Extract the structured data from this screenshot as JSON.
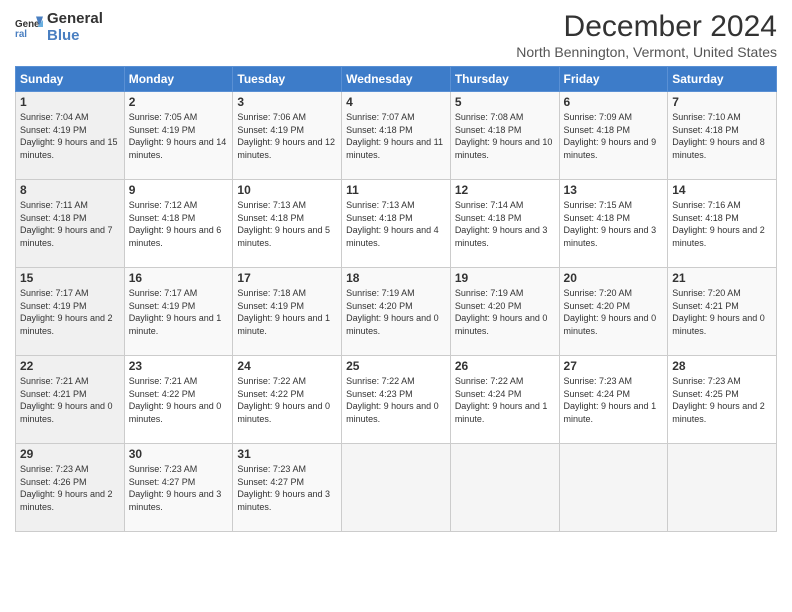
{
  "header": {
    "logo": {
      "general": "General",
      "blue": "Blue"
    },
    "title": "December 2024",
    "subtitle": "North Bennington, Vermont, United States"
  },
  "calendar": {
    "days": [
      "Sunday",
      "Monday",
      "Tuesday",
      "Wednesday",
      "Thursday",
      "Friday",
      "Saturday"
    ],
    "weeks": [
      [
        null,
        {
          "day": 2,
          "sunrise": "7:05 AM",
          "sunset": "4:19 PM",
          "daylight": "9 hours and 14 minutes."
        },
        {
          "day": 3,
          "sunrise": "7:06 AM",
          "sunset": "4:19 PM",
          "daylight": "9 hours and 12 minutes."
        },
        {
          "day": 4,
          "sunrise": "7:07 AM",
          "sunset": "4:18 PM",
          "daylight": "9 hours and 11 minutes."
        },
        {
          "day": 5,
          "sunrise": "7:08 AM",
          "sunset": "4:18 PM",
          "daylight": "9 hours and 10 minutes."
        },
        {
          "day": 6,
          "sunrise": "7:09 AM",
          "sunset": "4:18 PM",
          "daylight": "9 hours and 9 minutes."
        },
        {
          "day": 7,
          "sunrise": "7:10 AM",
          "sunset": "4:18 PM",
          "daylight": "9 hours and 8 minutes."
        }
      ],
      [
        {
          "day": 1,
          "sunrise": "7:04 AM",
          "sunset": "4:19 PM",
          "daylight": "9 hours and 15 minutes."
        },
        {
          "day": 9,
          "sunrise": "7:12 AM",
          "sunset": "4:18 PM",
          "daylight": "9 hours and 6 minutes."
        },
        {
          "day": 10,
          "sunrise": "7:13 AM",
          "sunset": "4:18 PM",
          "daylight": "9 hours and 5 minutes."
        },
        {
          "day": 11,
          "sunrise": "7:13 AM",
          "sunset": "4:18 PM",
          "daylight": "9 hours and 4 minutes."
        },
        {
          "day": 12,
          "sunrise": "7:14 AM",
          "sunset": "4:18 PM",
          "daylight": "9 hours and 3 minutes."
        },
        {
          "day": 13,
          "sunrise": "7:15 AM",
          "sunset": "4:18 PM",
          "daylight": "9 hours and 3 minutes."
        },
        {
          "day": 14,
          "sunrise": "7:16 AM",
          "sunset": "4:18 PM",
          "daylight": "9 hours and 2 minutes."
        }
      ],
      [
        {
          "day": 8,
          "sunrise": "7:11 AM",
          "sunset": "4:18 PM",
          "daylight": "9 hours and 7 minutes."
        },
        {
          "day": 16,
          "sunrise": "7:17 AM",
          "sunset": "4:19 PM",
          "daylight": "9 hours and 1 minute."
        },
        {
          "day": 17,
          "sunrise": "7:18 AM",
          "sunset": "4:19 PM",
          "daylight": "9 hours and 1 minute."
        },
        {
          "day": 18,
          "sunrise": "7:19 AM",
          "sunset": "4:20 PM",
          "daylight": "9 hours and 0 minutes."
        },
        {
          "day": 19,
          "sunrise": "7:19 AM",
          "sunset": "4:20 PM",
          "daylight": "9 hours and 0 minutes."
        },
        {
          "day": 20,
          "sunrise": "7:20 AM",
          "sunset": "4:20 PM",
          "daylight": "9 hours and 0 minutes."
        },
        {
          "day": 21,
          "sunrise": "7:20 AM",
          "sunset": "4:21 PM",
          "daylight": "9 hours and 0 minutes."
        }
      ],
      [
        {
          "day": 15,
          "sunrise": "7:17 AM",
          "sunset": "4:19 PM",
          "daylight": "9 hours and 2 minutes."
        },
        {
          "day": 23,
          "sunrise": "7:21 AM",
          "sunset": "4:22 PM",
          "daylight": "9 hours and 0 minutes."
        },
        {
          "day": 24,
          "sunrise": "7:22 AM",
          "sunset": "4:22 PM",
          "daylight": "9 hours and 0 minutes."
        },
        {
          "day": 25,
          "sunrise": "7:22 AM",
          "sunset": "4:23 PM",
          "daylight": "9 hours and 0 minutes."
        },
        {
          "day": 26,
          "sunrise": "7:22 AM",
          "sunset": "4:24 PM",
          "daylight": "9 hours and 1 minute."
        },
        {
          "day": 27,
          "sunrise": "7:23 AM",
          "sunset": "4:24 PM",
          "daylight": "9 hours and 1 minute."
        },
        {
          "day": 28,
          "sunrise": "7:23 AM",
          "sunset": "4:25 PM",
          "daylight": "9 hours and 2 minutes."
        }
      ],
      [
        {
          "day": 22,
          "sunrise": "7:21 AM",
          "sunset": "4:21 PM",
          "daylight": "9 hours and 0 minutes."
        },
        {
          "day": 30,
          "sunrise": "7:23 AM",
          "sunset": "4:27 PM",
          "daylight": "9 hours and 3 minutes."
        },
        {
          "day": 31,
          "sunrise": "7:23 AM",
          "sunset": "4:27 PM",
          "daylight": "9 hours and 3 minutes."
        },
        null,
        null,
        null,
        null
      ],
      [
        {
          "day": 29,
          "sunrise": "7:23 AM",
          "sunset": "4:26 PM",
          "daylight": "9 hours and 2 minutes."
        },
        null,
        null,
        null,
        null,
        null,
        null
      ]
    ]
  }
}
